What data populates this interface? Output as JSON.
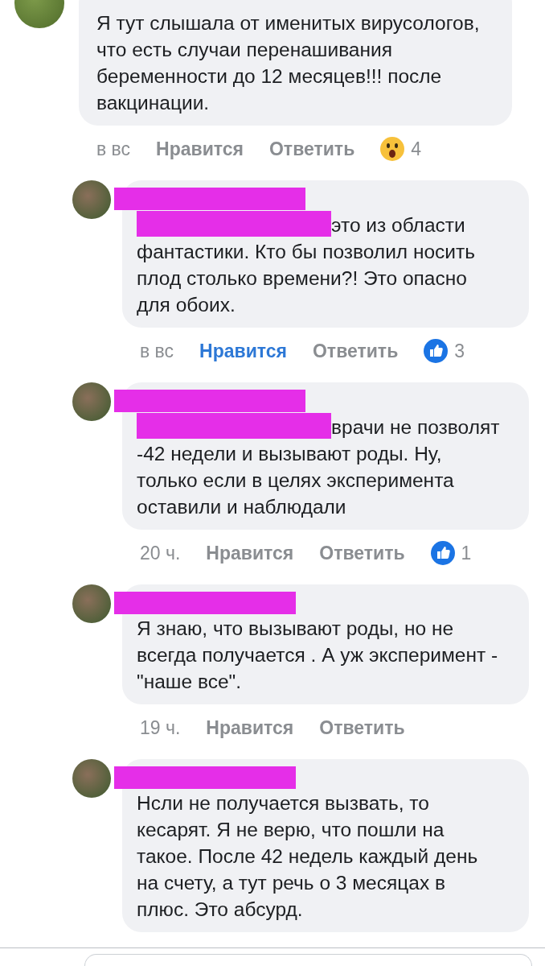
{
  "comments": [
    {
      "kind": "comment",
      "text": "Я тут слышала от именитых вирусологов, что есть случаи перенашивания беременности до 12 месяцев!!! после вакцинации.",
      "mention": false,
      "time": "в вс",
      "like": "Нравится",
      "liked": false,
      "reply": "Ответить",
      "reaction": {
        "kind": "wow",
        "count": "4"
      }
    },
    {
      "kind": "reply",
      "text": "это из области фантастики. Кто бы позволил носить плод столько времени?! Это опасно для обоих.",
      "mention": true,
      "time": "в вс",
      "like": "Нравится",
      "liked": true,
      "reply": "Ответить",
      "reaction": {
        "kind": "like",
        "count": "3"
      }
    },
    {
      "kind": "reply",
      "text": "врачи не позволят -42 недели и вызывают роды. Ну, только если в целях эксперимента оставили и наблюдали",
      "mention": true,
      "time": "20 ч.",
      "like": "Нравится",
      "liked": false,
      "reply": "Ответить",
      "reaction": {
        "kind": "like",
        "count": "1"
      }
    },
    {
      "kind": "reply",
      "text": "Я знаю, что вызывают роды, но не всегда получается . А уж эксперимент - \"наше все\".",
      "mention": false,
      "time": "19 ч.",
      "like": "Нравится",
      "liked": false,
      "reply": "Ответить"
    },
    {
      "kind": "reply",
      "text": "Нсли не получается вызвать, то кесарят. Я не верю, что пошли на такое. После 42 недель каждый день на счету, а тут речь о 3 месяцах в плюс. Это абсурд.",
      "mention": false
    }
  ]
}
